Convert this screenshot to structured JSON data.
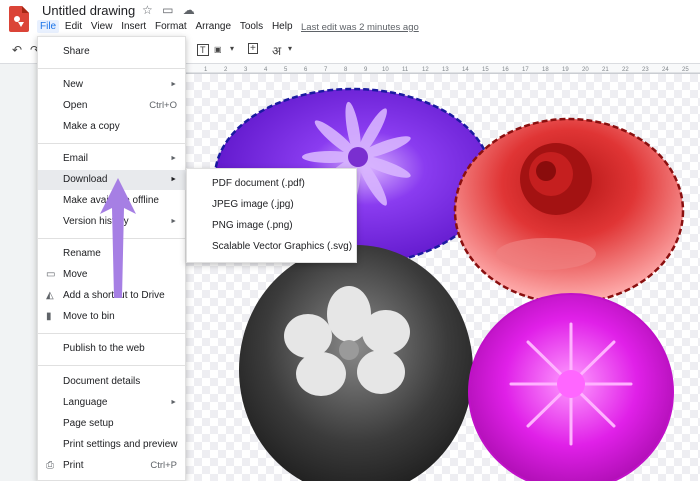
{
  "header": {
    "title": "Untitled drawing",
    "title_icons": [
      "star-icon",
      "folder-icon",
      "cloud-icon"
    ],
    "last_edit": "Last edit was 2 minutes ago"
  },
  "menubar": [
    "File",
    "Edit",
    "View",
    "Insert",
    "Format",
    "Arrange",
    "Tools",
    "Help"
  ],
  "toolbar": {
    "undo": "↶",
    "redo": "↷",
    "text_box": "T",
    "dropdown": "▾",
    "comment": "+",
    "special": "अ",
    "special_dropdown": "▾"
  },
  "file_menu": {
    "share": "Share",
    "new": "New",
    "open": "Open",
    "open_shortcut": "Ctrl+O",
    "make_copy": "Make a copy",
    "email": "Email",
    "download": "Download",
    "make_available_offline": "Make available offline",
    "version_history": "Version history",
    "rename": "Rename",
    "move": "Move",
    "add_shortcut": "Add a shortcut to Drive",
    "move_to_bin": "Move to bin",
    "publish": "Publish to the web",
    "document_details": "Document details",
    "language": "Language",
    "page_setup": "Page setup",
    "print_settings": "Print settings and preview",
    "print": "Print",
    "print_shortcut": "Ctrl+P"
  },
  "download_submenu": [
    "PDF document (.pdf)",
    "JPEG image (.jpg)",
    "PNG image (.png)",
    "Scalable Vector Graphics (.svg)"
  ],
  "colors": {
    "app_red": "#db4437",
    "active_blue": "#1a73e8",
    "arrow_purple": "#a67fe4"
  }
}
